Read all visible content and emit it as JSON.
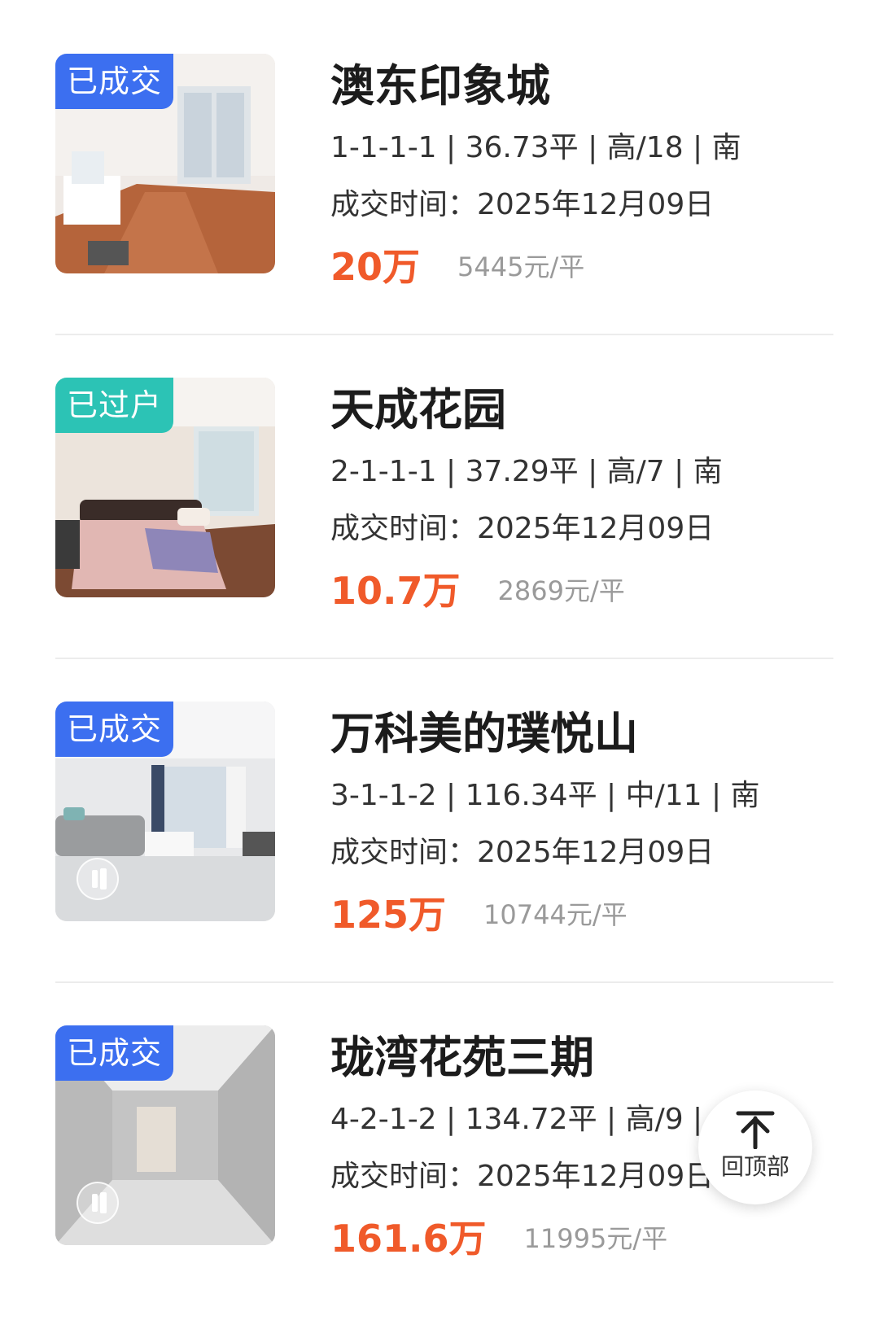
{
  "listings": [
    {
      "status": "已成交",
      "title": "澳东印象城",
      "specs": "1-1-1-1 | 36.73平 | 高/18 | 南",
      "deal_time": "成交时间：2025年12月09日",
      "price": "20万",
      "unit_price": "5445元/平"
    },
    {
      "status": "已过户",
      "title": "天成花园",
      "specs": "2-1-1-1 | 37.29平 | 高/7 | 南",
      "deal_time": "成交时间：2025年12月09日",
      "price": "10.7万",
      "unit_price": "2869元/平"
    },
    {
      "status": "已成交",
      "title": "万科美的璞悦山",
      "specs": "3-1-1-2 | 116.34平 | 中/11 | 南",
      "deal_time": "成交时间：2025年12月09日",
      "price": "125万",
      "unit_price": "10744元/平"
    },
    {
      "status": "已成交",
      "title": "珑湾花苑三期",
      "specs": "4-2-1-2 | 134.72平 | 高/9 |",
      "deal_time": "成交时间：2025年12月09日",
      "price": "161.6万",
      "unit_price": "11995元/平"
    }
  ],
  "back_to_top": {
    "label": "回顶部",
    "icon": "arrow-up-icon"
  },
  "colors": {
    "badge_deal": "#3c6ff0",
    "badge_transferred": "#2cc3b5",
    "price": "#f05a2a",
    "unit_price": "#9a9a9a"
  }
}
